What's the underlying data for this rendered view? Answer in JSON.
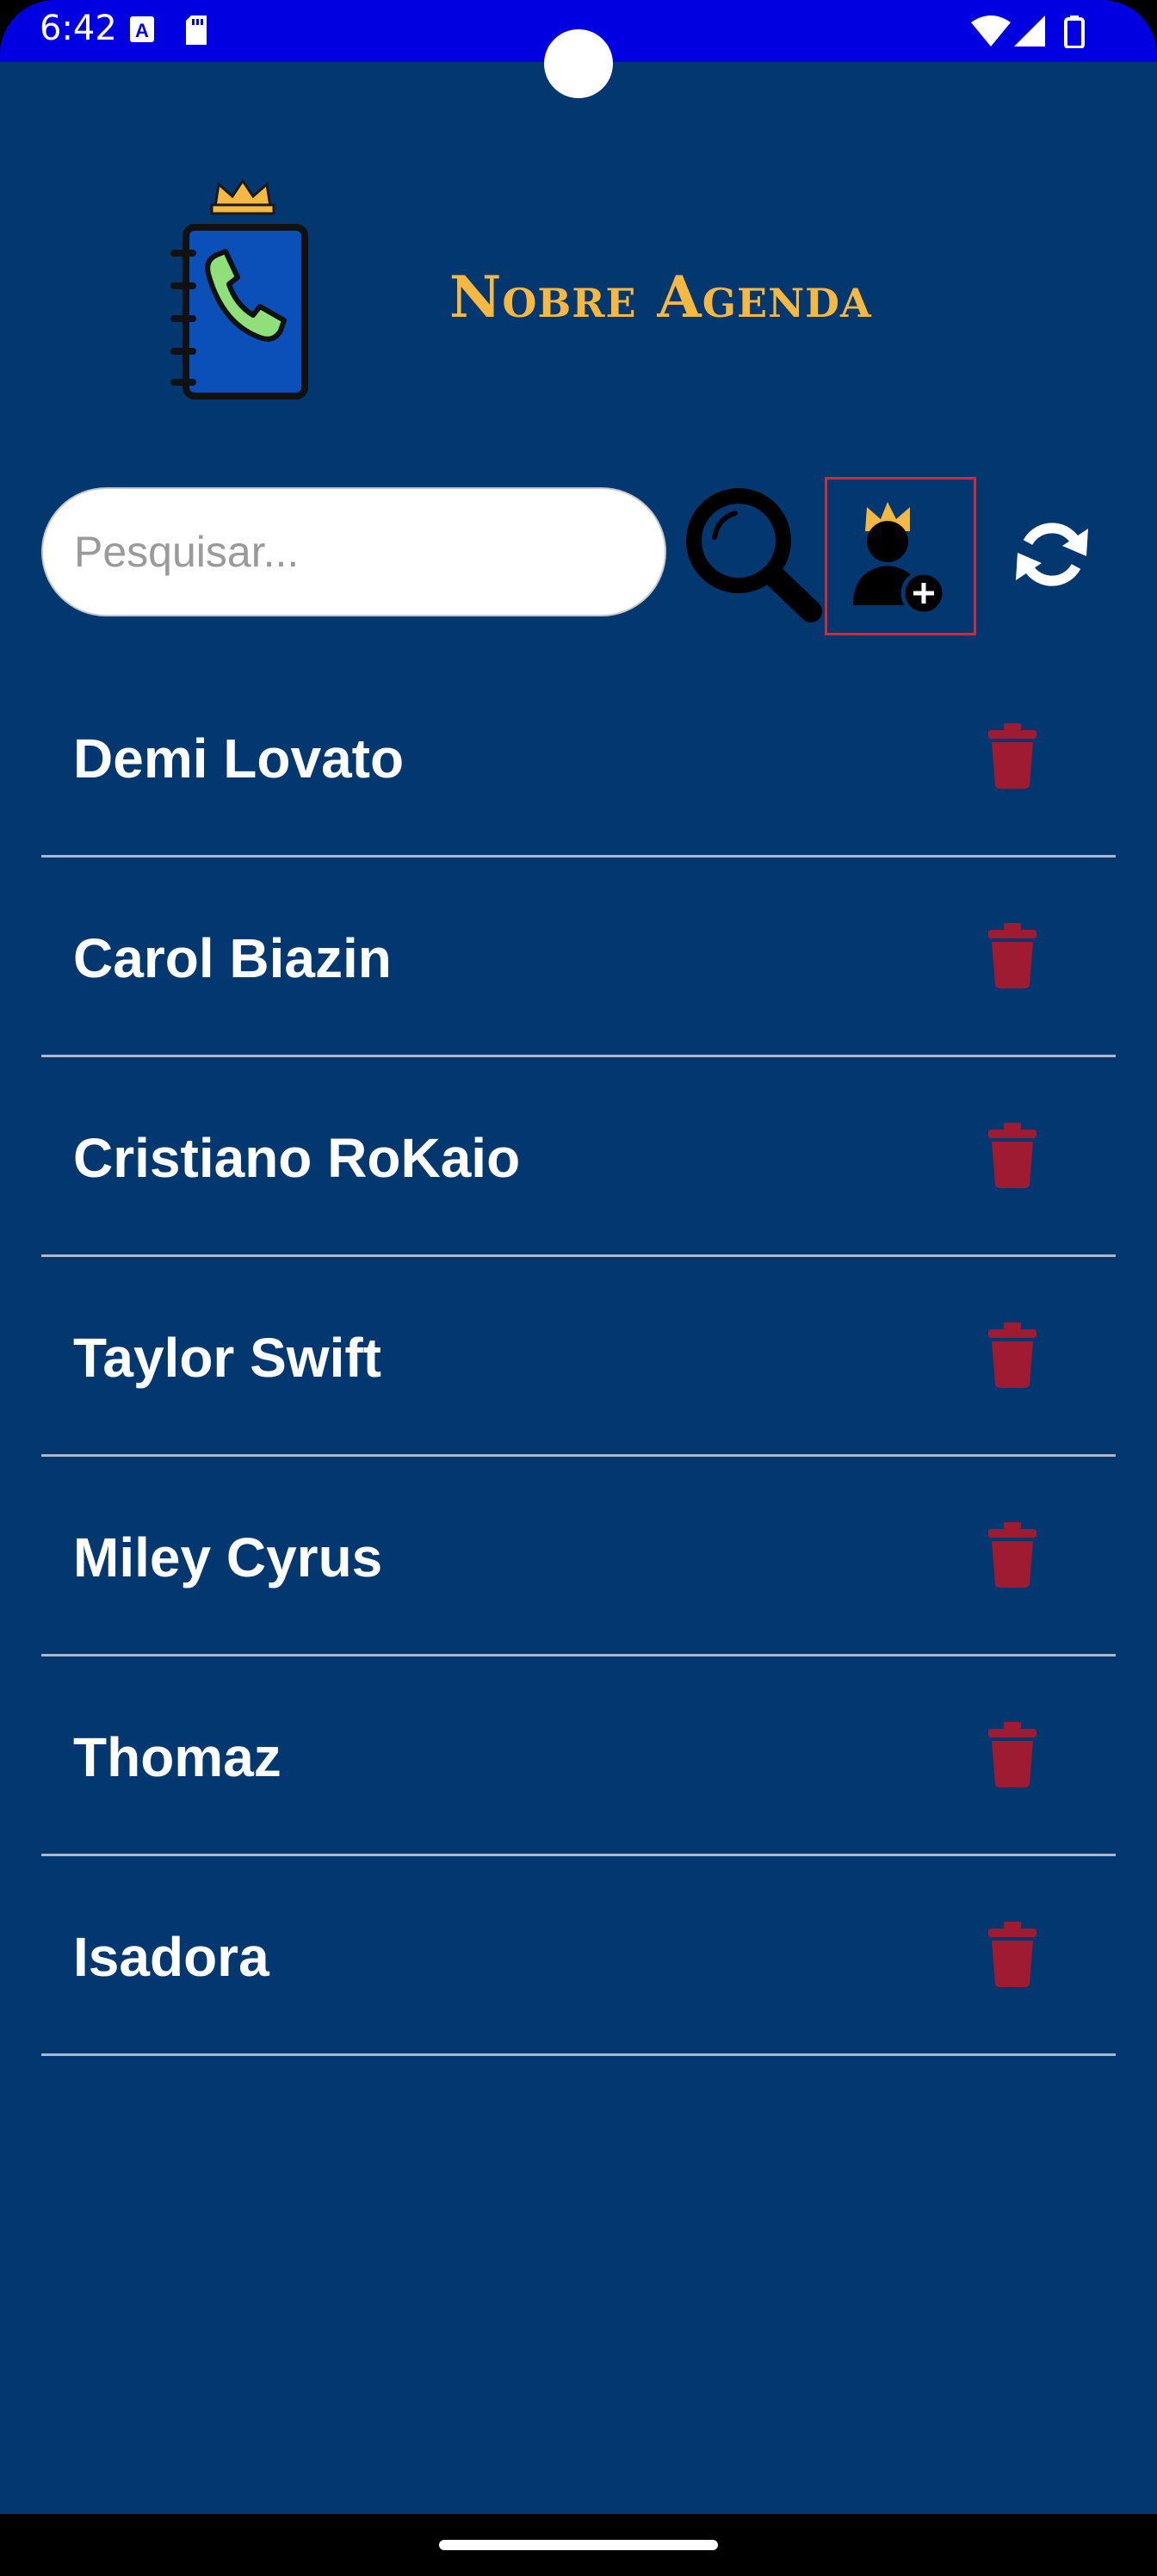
{
  "status_bar": {
    "time": "6:42",
    "icons": [
      "a-notification-icon",
      "sd-card-icon",
      "wifi-icon",
      "signal-icon",
      "battery-icon"
    ]
  },
  "header": {
    "title": "Nobre Agenda",
    "logo_icon": "phonebook-crown-icon"
  },
  "search": {
    "placeholder": "Pesquisar...",
    "value": ""
  },
  "toolbar": {
    "search_icon": "search-icon",
    "add_contact_icon": "add-contact-crown-icon",
    "refresh_icon": "refresh-icon"
  },
  "contacts": [
    {
      "name": "Demi Lovato"
    },
    {
      "name": "Carol Biazin"
    },
    {
      "name": "Cristiano RoKaio"
    },
    {
      "name": "Taylor Swift"
    },
    {
      "name": "Miley Cyrus"
    },
    {
      "name": "Thomaz"
    },
    {
      "name": "Isadora"
    }
  ],
  "colors": {
    "background": "#023770",
    "status_bar": "#0000e0",
    "title": "#f5b843",
    "delete_icon": "#9e1b32",
    "add_button_border": "#d0293a",
    "divider": "#a9b8ca"
  }
}
